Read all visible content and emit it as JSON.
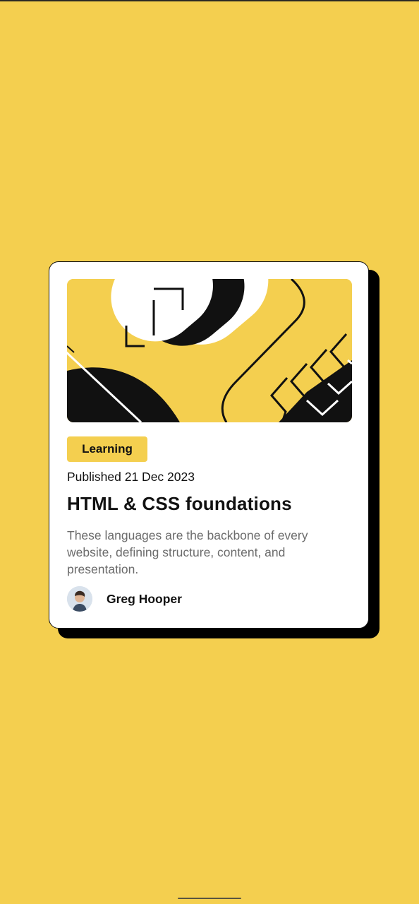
{
  "card": {
    "tag": "Learning",
    "published": "Published 21 Dec 2023",
    "title": "HTML & CSS foundations",
    "description": "These languages are the backbone of every website, defining structure, content, and presentation.",
    "author": "Greg Hooper"
  },
  "colors": {
    "background": "#f4cf4f",
    "card": "#ffffff",
    "text": "#111111",
    "muted": "#6b6b6b"
  },
  "icons": {
    "hero": "abstract-illustration",
    "avatar": "author-avatar"
  }
}
